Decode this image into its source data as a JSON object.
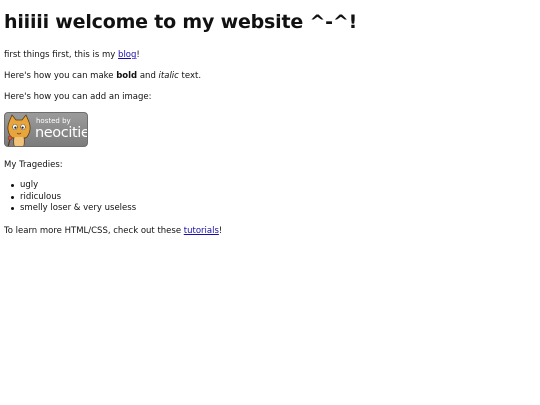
{
  "heading": "hiiiii welcome to my website ^-^!",
  "intro": {
    "prefix": "first things first, this is my ",
    "link": "blog",
    "suffix": "!"
  },
  "format_line": {
    "prefix": "Here's how you can make ",
    "bold": "bold",
    "middle": " and ",
    "italic": "italic",
    "suffix": " text."
  },
  "image_line": "Here's how you can add an image:",
  "badge": {
    "hosted_by": "hosted by",
    "name": "neocities",
    "icon": "neocities-cat-icon"
  },
  "tragedies_title": "My Tragedies:",
  "tragedies": [
    "ugly",
    "ridiculous",
    "smelly loser & very useless"
  ],
  "learn_more": {
    "prefix": "To learn more HTML/CSS, check out these ",
    "link": "tutorials",
    "suffix": "!"
  },
  "colors": {
    "link": "#1a0dab",
    "badge_bg": "#8a8a8a",
    "cat_orange": "#e8a53b"
  }
}
